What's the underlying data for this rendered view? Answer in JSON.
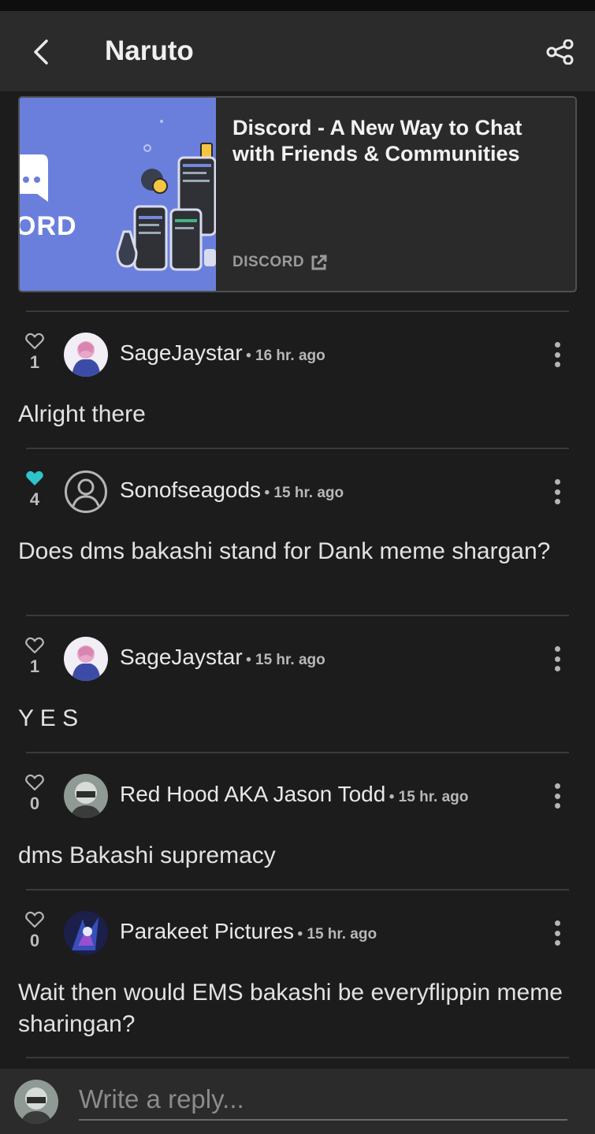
{
  "header": {
    "title": "Naruto",
    "back_icon": "chevron-left-icon",
    "share_icon": "share-icon"
  },
  "link_preview": {
    "title": "Discord - A New Way to Chat with Friends & Communities",
    "source": "DISCORD",
    "thumb_text": "ORD",
    "thumb_color": "#6a7fdc"
  },
  "comments": [
    {
      "username": "SageJaystar",
      "time": "• 16 hr. ago",
      "likes": "1",
      "liked": false,
      "text": "Alright there",
      "avatar": "avatar-pink-character"
    },
    {
      "username": "Sonofseagods",
      "time": "• 15 hr. ago",
      "likes": "4",
      "liked": true,
      "text": "Does dms bakashi stand for Dank meme shargan?",
      "avatar": "avatar-default"
    },
    {
      "username": "SageJaystar",
      "time": "• 15 hr. ago",
      "likes": "1",
      "liked": false,
      "text": "Y E S",
      "avatar": "avatar-pink-character"
    },
    {
      "username": "Red Hood AKA Jason Todd",
      "time": "• 15 hr. ago",
      "likes": "0",
      "liked": false,
      "text": "dms Bakashi supremacy",
      "avatar": "avatar-masked-figure"
    },
    {
      "username": "Parakeet Pictures",
      "time": "• 15 hr. ago",
      "likes": "0",
      "liked": false,
      "text": "Wait then would EMS bakashi be everyflippin meme sharingan?",
      "avatar": "avatar-blue-art"
    }
  ],
  "reply": {
    "placeholder": "Write a reply..."
  },
  "colors": {
    "liked": "#2ec4c9",
    "background": "#1c1c1d",
    "bar": "#2b2b2c"
  }
}
